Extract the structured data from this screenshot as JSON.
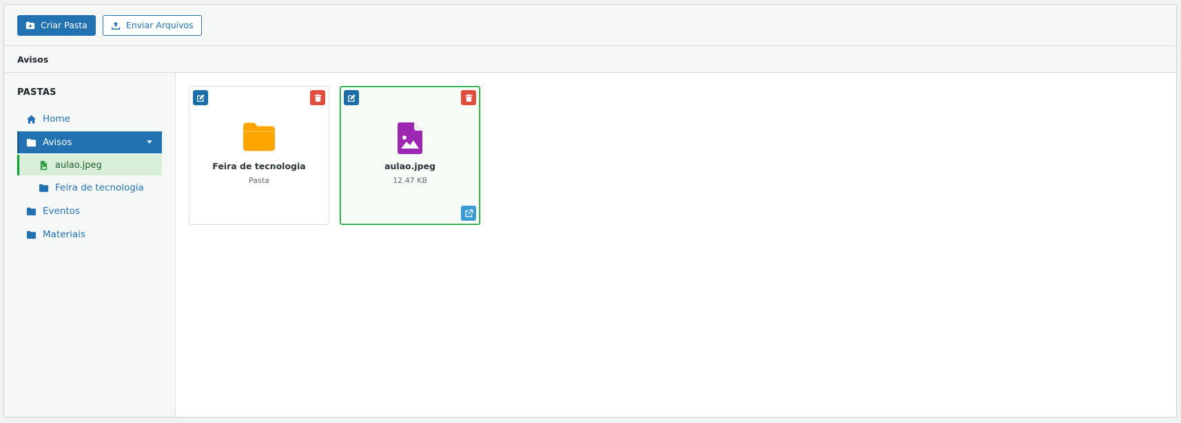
{
  "toolbar": {
    "create_folder_label": "Criar Pasta",
    "upload_files_label": "Enviar Arquivos"
  },
  "breadcrumb": {
    "current": "Avisos"
  },
  "sidebar": {
    "title": "PASTAS",
    "items": [
      {
        "label": "Home",
        "icon": "home-icon"
      },
      {
        "label": "Avisos",
        "icon": "folder-icon",
        "state": "active-expanded"
      },
      {
        "label": "aulao.jpeg",
        "icon": "image-file-icon",
        "state": "selected"
      },
      {
        "label": "Feira de tecnologia",
        "icon": "folder-icon"
      },
      {
        "label": "Eventos",
        "icon": "folder-icon"
      },
      {
        "label": "Materiais",
        "icon": "folder-icon"
      }
    ]
  },
  "cards": [
    {
      "name": "Feira de tecnologia",
      "meta": "Pasta",
      "type": "folder",
      "icon": "folder-icon"
    },
    {
      "name": "aulao.jpeg",
      "meta": "12.47 KB",
      "type": "image",
      "icon": "image-file-icon",
      "selected": true
    }
  ],
  "colors": {
    "primary": "#2271b1",
    "folder": "#ffa500",
    "image_file": "#9c27b0",
    "delete": "#e04e3d",
    "selected_border": "#00a32a"
  }
}
